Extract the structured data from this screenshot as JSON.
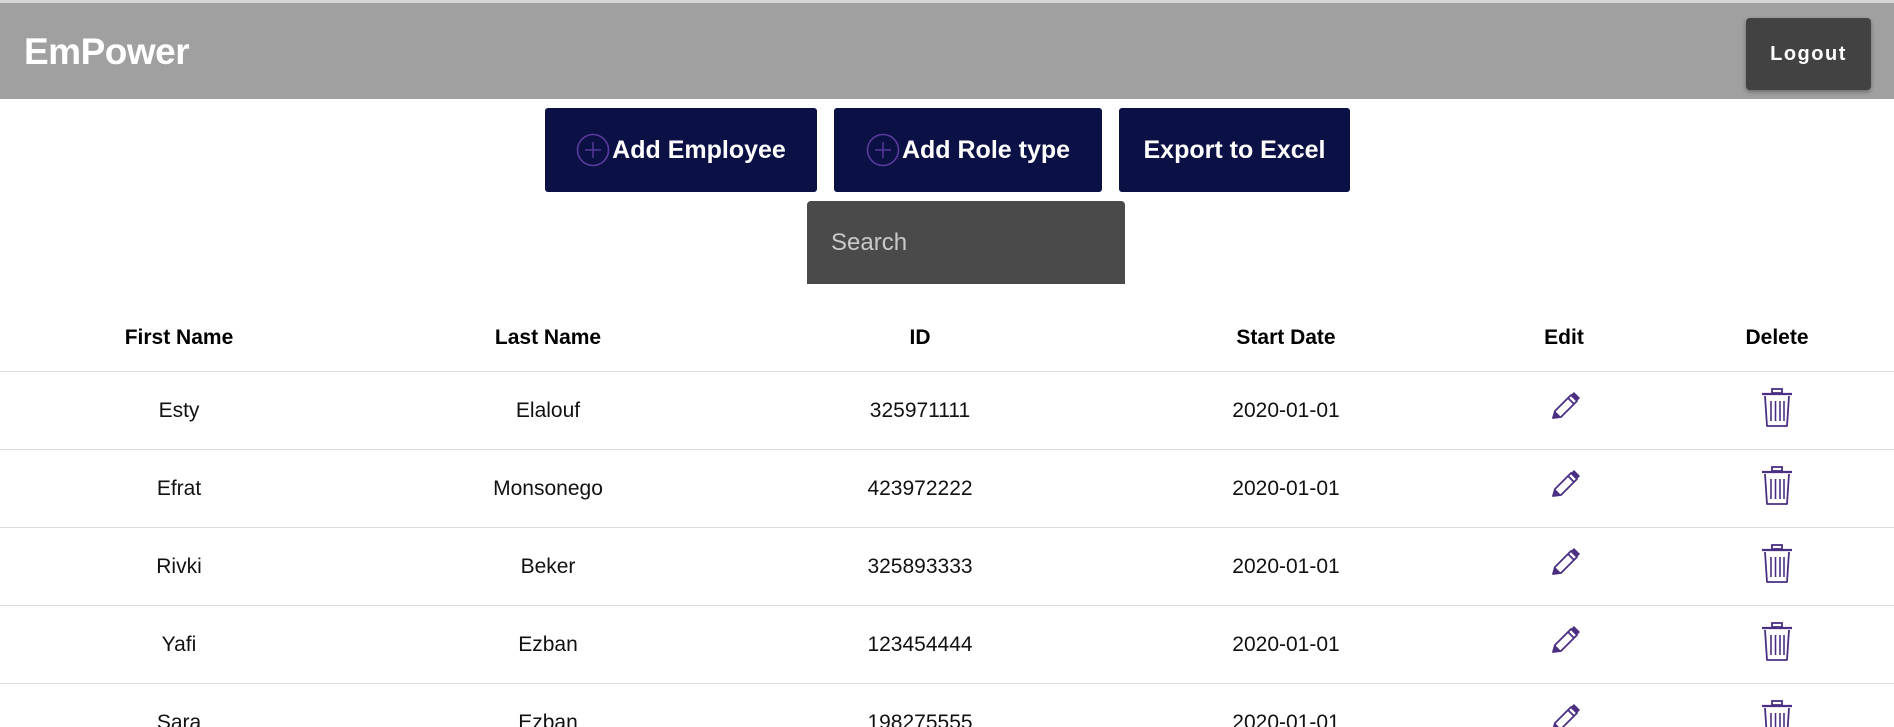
{
  "app": {
    "brand": "EmPower",
    "logout_label": "Logout"
  },
  "actions": {
    "add_employee_label": "Add Employee",
    "add_role_label": "Add Role type",
    "export_label": "Export to Excel",
    "plus_icon": "plus-circle-icon"
  },
  "search": {
    "placeholder": "Search",
    "value": ""
  },
  "table": {
    "columns": [
      "First Name",
      "Last Name",
      "ID",
      "Start Date",
      "Edit",
      "Delete"
    ],
    "edit_icon": "pencil-icon",
    "delete_icon": "trash-icon",
    "icon_color": "#4b2f82",
    "rows": [
      {
        "first": "Esty",
        "last": "Elalouf",
        "id": "325971111",
        "start": "2020-01-01"
      },
      {
        "first": "Efrat",
        "last": "Monsonego",
        "id": "423972222",
        "start": "2020-01-01"
      },
      {
        "first": "Rivki",
        "last": "Beker",
        "id": "325893333",
        "start": "2020-01-01"
      },
      {
        "first": "Yafi",
        "last": "Ezban",
        "id": "123454444",
        "start": "2020-01-01"
      },
      {
        "first": "Sara",
        "last": "Ezban",
        "id": "198275555",
        "start": "2020-01-01"
      }
    ]
  },
  "colors": {
    "topbar": "#a0a0a0",
    "button_navy": "#0b1145",
    "logout": "#424242",
    "search_bg": "#4a4a4a"
  }
}
